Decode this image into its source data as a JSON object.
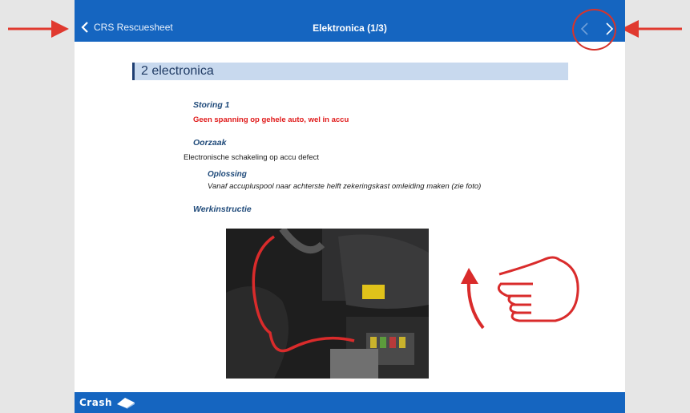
{
  "navbar": {
    "back_label": "CRS Rescuesheet",
    "title": "Elektronica (1/3)",
    "prev_icon": "chevron-left-icon",
    "next_icon": "chevron-right-icon"
  },
  "document": {
    "section_title": "2 electronica",
    "fault_heading": "Storing 1",
    "fault_text": "Geen spanning op gehele auto, wel in accu",
    "cause_heading": "Oorzaak",
    "cause_text": "Electronische schakeling op accu defect",
    "solution_heading": "Oplossing",
    "solution_text": "Vanaf accupluspool  naar achterste helft zekeringskast omleiding maken (zie foto)",
    "instruction_heading": "Werkinstructie"
  },
  "footer": {
    "logo_text": "Crash"
  },
  "colors": {
    "navbar": "#1565c0",
    "annotation_red": "#d6342c",
    "section_bg": "#c8d9ee",
    "heading_blue": "#1f4a7a",
    "fault_red": "#e01a1a"
  }
}
